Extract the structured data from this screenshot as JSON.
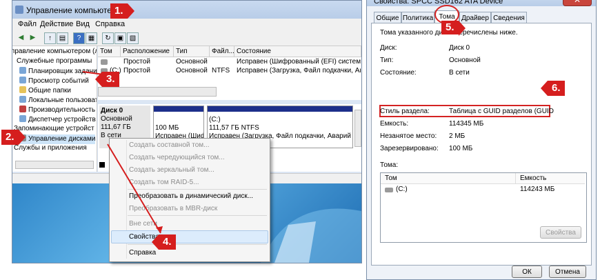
{
  "left": {
    "title": "Управление компьютером",
    "menu": [
      "Файл",
      "Действие",
      "Вид",
      "Справка"
    ],
    "toolbar_icons": [
      "back-icon",
      "forward-icon",
      "up-icon",
      "show-tree-icon",
      "help-icon",
      "properties-icon",
      "export-icon",
      "refresh-icon"
    ],
    "tree": [
      "Управление компьютером (л",
      "Служебные программы",
      "Планировщик задани",
      "Просмотр событий",
      "Общие папки",
      "Локальные пользоват",
      "Производительность",
      "Диспетчер устройств",
      "Запоминающие устройст",
      "Управление дисками",
      "Службы и приложения"
    ],
    "columns": [
      "Том",
      "Расположение",
      "Тип",
      "Файл...",
      "Состояние"
    ],
    "rows": [
      [
        "",
        "Простой",
        "Основной",
        "",
        "Исправен (Шифрованный (EFI) системн"
      ],
      [
        "(C:)",
        "Простой",
        "Основной",
        "NTFS",
        "Исправен (Загрузка, Файл подкачки, Ав"
      ]
    ],
    "disk": {
      "name": "Диск 0",
      "type": "Основной",
      "size": "111,67 ГБ",
      "status": "В сети"
    },
    "part1": {
      "size": "100 МБ",
      "status": "Исправен (Шиф"
    },
    "part2": {
      "name": "(C:)",
      "size": "111,57 ГБ NTFS",
      "status": "Исправен (Загрузка, Файл подкачки, Аварий"
    }
  },
  "context_menu": {
    "items": [
      {
        "label": "Создать составной том...",
        "disabled": true
      },
      {
        "label": "Создать чередующийся том...",
        "disabled": true
      },
      {
        "label": "Создать зеркальный том...",
        "disabled": true
      },
      {
        "label": "Создать том RAID-5...",
        "disabled": true
      },
      {
        "label": "Преобразовать в динамический диск...",
        "disabled": false
      },
      {
        "label": "Преобразовать в MBR-диск",
        "disabled": true
      },
      {
        "label": "Вне сети",
        "disabled": true
      },
      {
        "label": "Свойства",
        "disabled": false
      },
      {
        "label": "Справка",
        "disabled": false
      }
    ]
  },
  "right": {
    "title": "Свойства: SPCC SSD162 ATA Device",
    "close": "✕",
    "tabs": [
      "Общие",
      "Политика",
      "Тома",
      "Драйвер",
      "Сведения"
    ],
    "active_tab": "Тома",
    "intro": "Тома указанного диска перечислены ниже.",
    "props": [
      {
        "label": "Диск:",
        "value": "Диск 0"
      },
      {
        "label": "Тип:",
        "value": "Основной"
      },
      {
        "label": "Состояние:",
        "value": "В сети"
      },
      {
        "label": "Стиль раздела:",
        "value": "Таблица с GUID разделов (GUID"
      },
      {
        "label": "Емкость:",
        "value": "114345 МБ"
      },
      {
        "label": "Незанятое место:",
        "value": "2 МБ"
      },
      {
        "label": "Зарезервировано:",
        "value": "100 МБ"
      }
    ],
    "volumes_label": "Тома:",
    "vol_columns": [
      "Том",
      "Емкость"
    ],
    "vol_rows": [
      [
        "(C:)",
        "114243 МБ"
      ]
    ],
    "props_button": "Свойства",
    "ok": "ОК",
    "cancel": "Отмена"
  },
  "callouts": [
    "1.",
    "2.",
    "3.",
    "4.",
    "5.",
    "6."
  ],
  "colors": {
    "callout": "#d51e1e",
    "disk_bar": "#1c2f8a",
    "desktop": "#2f86c9"
  }
}
